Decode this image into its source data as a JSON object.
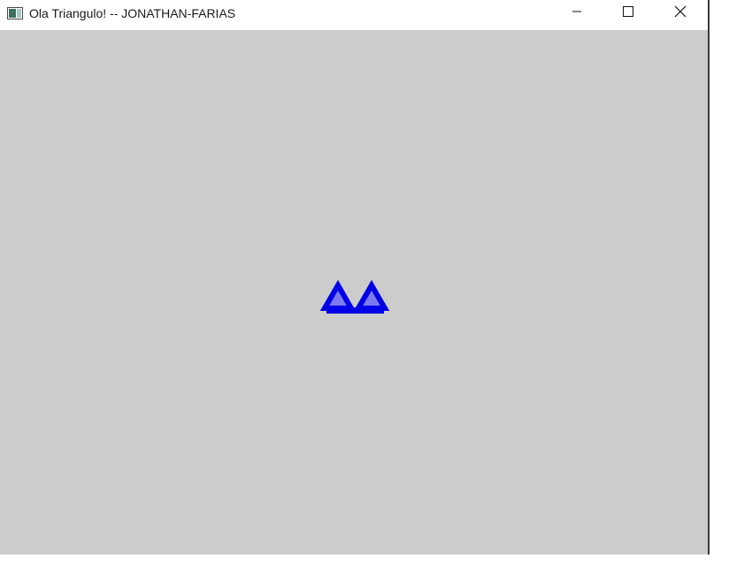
{
  "window": {
    "title": "Ola Triangulo! -- JONATHAN-FARIAS"
  },
  "icons": {
    "app": "app-window-icon",
    "minimize": "minimize-icon",
    "maximize": "maximize-icon",
    "close": "close-icon"
  },
  "colors": {
    "client_background": "#cccccc",
    "triangle_outline": "#0000e6",
    "triangle_fill": "#7a7aee"
  }
}
